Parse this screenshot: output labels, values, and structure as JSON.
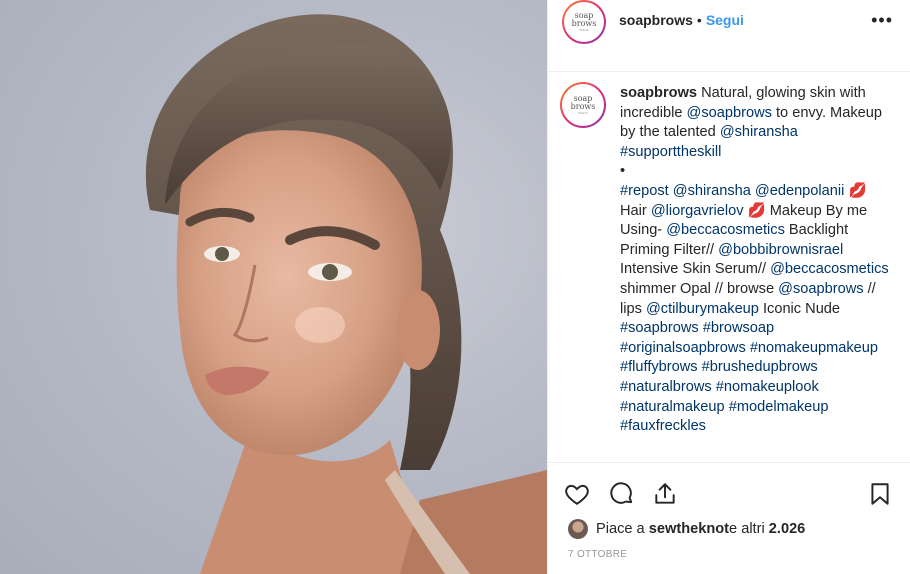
{
  "header": {
    "avatar_logo_line1": "soap",
    "avatar_logo_line2": "brows",
    "avatar_logo_small": "WACS",
    "username": "soapbrows",
    "separator": "•",
    "follow_label": "Segui",
    "more_label": "•••"
  },
  "caption": {
    "username": "soapbrows",
    "segments": [
      {
        "t": " Natural, glowing skin with incredible ",
        "link": false
      },
      {
        "t": "@soapbrows",
        "link": true
      },
      {
        "t": " to envy. Makeup by the talented ",
        "link": false
      },
      {
        "t": "@shiransha",
        "link": true
      },
      {
        "t": " ",
        "link": false
      },
      {
        "t": "#supporttheskill",
        "link": true
      },
      {
        "t": "\n•\n",
        "link": false
      },
      {
        "t": "#repost",
        "link": true
      },
      {
        "t": " ",
        "link": false
      },
      {
        "t": "@shiransha",
        "link": true
      },
      {
        "t": " ",
        "link": false
      },
      {
        "t": "@edenpolanii",
        "link": true
      },
      {
        "t": " 💋\nHair ",
        "link": false
      },
      {
        "t": "@liorgavrielov",
        "link": true
      },
      {
        "t": " 💋  Makeup By me Using- ",
        "link": false
      },
      {
        "t": "@beccacosmetics",
        "link": true
      },
      {
        "t": " Backlight Priming Filter// ",
        "link": false
      },
      {
        "t": "@bobbibrownisrael",
        "link": true
      },
      {
        "t": " Intensive Skin Serum// ",
        "link": false
      },
      {
        "t": "@beccacosmetics",
        "link": true
      },
      {
        "t": " shimmer Opal // browse ",
        "link": false
      },
      {
        "t": "@soapbrows",
        "link": true
      },
      {
        "t": " // lips ",
        "link": false
      },
      {
        "t": "@ctilburymakeup",
        "link": true
      },
      {
        "t": " Iconic Nude ",
        "link": false
      },
      {
        "t": "#soapbrows",
        "link": true
      },
      {
        "t": " ",
        "link": false
      },
      {
        "t": "#browsoap",
        "link": true
      },
      {
        "t": " ",
        "link": false
      },
      {
        "t": "#originalsoapbrows",
        "link": true
      },
      {
        "t": " ",
        "link": false
      },
      {
        "t": "#nomakeupmakeup",
        "link": true
      },
      {
        "t": " ",
        "link": false
      },
      {
        "t": "#fluffybrows",
        "link": true
      },
      {
        "t": " ",
        "link": false
      },
      {
        "t": "#brushedupbrows",
        "link": true
      },
      {
        "t": " ",
        "link": false
      },
      {
        "t": "#naturalbrows",
        "link": true
      },
      {
        "t": " ",
        "link": false
      },
      {
        "t": "#nomakeuplook",
        "link": true
      },
      {
        "t": " ",
        "link": false
      },
      {
        "t": "#naturalmakeup",
        "link": true
      },
      {
        "t": " ",
        "link": false
      },
      {
        "t": "#modelmakeup",
        "link": true
      },
      {
        "t": " ",
        "link": false
      },
      {
        "t": "#fauxfreckles",
        "link": true
      }
    ]
  },
  "actions": {
    "like_icon": "heart-icon",
    "comment_icon": "comment-icon",
    "share_icon": "share-icon",
    "save_icon": "bookmark-icon"
  },
  "likes": {
    "prefix": "Piace a ",
    "user": "sewtheknot",
    "middle": " e altri ",
    "count": "2.026"
  },
  "date": "7 OTTOBRE",
  "colors": {
    "link": "#003569",
    "follow": "#3897f0",
    "text": "#262626",
    "muted": "#999999"
  }
}
